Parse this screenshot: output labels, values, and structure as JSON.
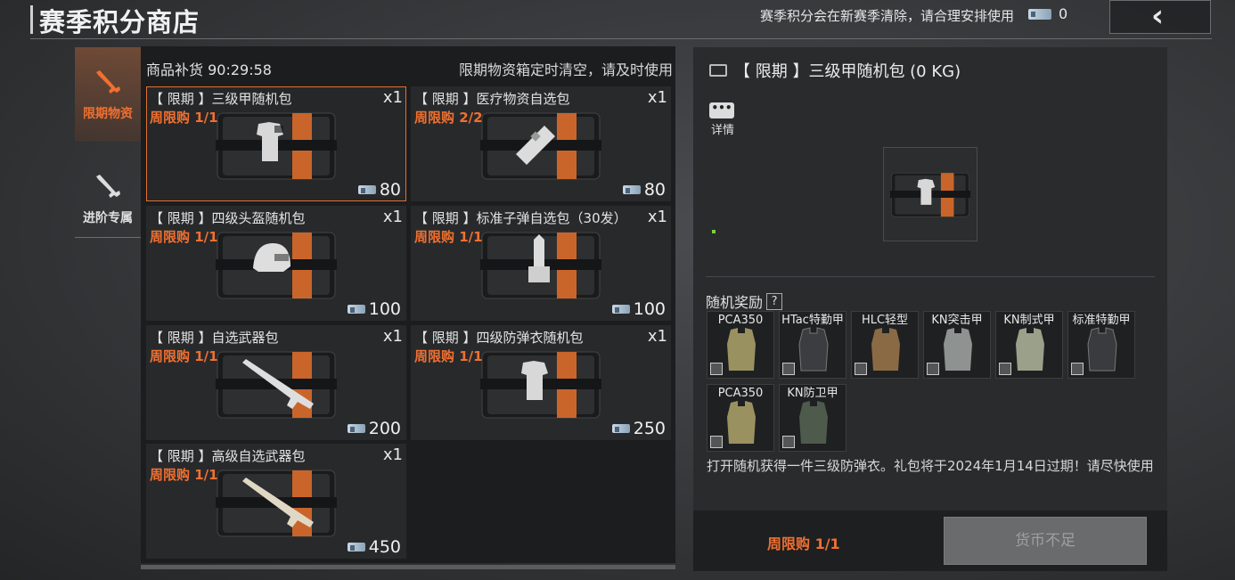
{
  "header": {
    "title": "赛季积分商店",
    "notice": "赛季积分会在新赛季清除，请合理安排使用",
    "currency_amount": "0",
    "back_icon": "chevron-left-icon"
  },
  "tabs": [
    {
      "label": "限期物资",
      "icon": "rifle-icon",
      "active": true
    },
    {
      "label": "进阶专属",
      "icon": "rifle-icon",
      "active": false
    }
  ],
  "grid": {
    "restock": "商品补货 90:29:58",
    "clear_notice": "限期物资箱定时清空，请及时使用",
    "items": [
      {
        "name": "【 限期 】三级甲随机包",
        "limit": "周限购 1/1",
        "qty": "x1",
        "price": "80",
        "content": "vest"
      },
      {
        "name": "【 限期 】医疗物资自选包",
        "limit": "周限购 2/2",
        "qty": "x1",
        "price": "80",
        "content": "medical"
      },
      {
        "name": "【 限期 】四级头盔随机包",
        "limit": "周限购 1/1",
        "qty": "x1",
        "price": "100",
        "content": "helmet"
      },
      {
        "name": "【 限期 】标准子弹自选包（30发）",
        "limit": "周限购 1/1",
        "qty": "x1",
        "price": "100",
        "content": "ammo"
      },
      {
        "name": "【 限期 】自选武器包",
        "limit": "周限购 1/1",
        "qty": "x1",
        "price": "200",
        "content": "rifle"
      },
      {
        "name": "【 限期 】四级防弹衣随机包",
        "limit": "周限购 1/1",
        "qty": "x1",
        "price": "250",
        "content": "vest"
      },
      {
        "name": "【 限期 】高级自选武器包",
        "limit": "周限购 1/1",
        "qty": "x1",
        "price": "450",
        "content": "rifle"
      }
    ]
  },
  "detail": {
    "title": "【 限期 】三级甲随机包 (0 KG)",
    "more_label": "详情",
    "rewards_label": "随机奖励",
    "rewards": [
      {
        "name": "PCA350",
        "color": "#9a9160"
      },
      {
        "name": "HTac特勤甲",
        "color": "#3c3d40"
      },
      {
        "name": "HLC轻型",
        "color": "#8a6a44"
      },
      {
        "name": "KN突击甲",
        "color": "#8e9290"
      },
      {
        "name": "KN制式甲",
        "color": "#9aa08a"
      },
      {
        "name": "标准特勤甲",
        "color": "#3a3b3e"
      },
      {
        "name": "PCA350",
        "color": "#9a9160"
      },
      {
        "name": "KN防卫甲",
        "color": "#4e5a4c"
      }
    ],
    "description": "打开随机获得一件三级防弹衣。礼包将于2024年1月14日过期！请尽快使用",
    "footer_limit": "周限购 1/1",
    "buy_label": "货币不足"
  },
  "colors": {
    "accent": "#f07030",
    "panel": "#2a2b2d"
  }
}
